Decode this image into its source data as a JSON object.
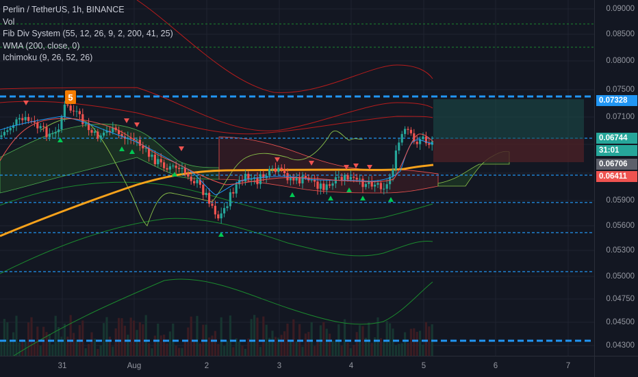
{
  "legend": {
    "symbol_line": "Perlin / TetherUS, 1h, BINANCE",
    "indicators": [
      "Vol",
      "Fib Div System (55, 12, 26, 9, 2, 200, 41, 25)",
      "WMA (200, close, 0)",
      "Ichimoku (9, 26, 52, 26)"
    ]
  },
  "price_scale": {
    "labels": [
      "0.09000",
      "0.08500",
      "0.08000",
      "0.07500",
      "0.07100",
      "0.06500",
      "0.05900",
      "0.05600",
      "0.05300",
      "0.05000",
      "0.04750",
      "0.04500",
      "0.04300"
    ],
    "badges": [
      {
        "value": "0.07328",
        "color": "#2196f3"
      },
      {
        "value": "0.06744",
        "color": "#26a69a"
      },
      {
        "value": "31:01",
        "color": "#26a69a"
      },
      {
        "value": "0.06706",
        "color": "#5d606b"
      },
      {
        "value": "0.06411",
        "color": "#ef5350"
      }
    ]
  },
  "time_scale": {
    "labels": [
      "31",
      "Aug",
      "2",
      "3",
      "4",
      "5",
      "6",
      "7"
    ]
  },
  "marker": {
    "label": "5"
  },
  "colors": {
    "background": "#131722",
    "up": "#26a69a",
    "down": "#ef5350",
    "wma": "#f7a21b",
    "level_lines": "#2196f3",
    "fib_bands": "#b71c1c",
    "green_lines": "#1b8a2e"
  }
}
